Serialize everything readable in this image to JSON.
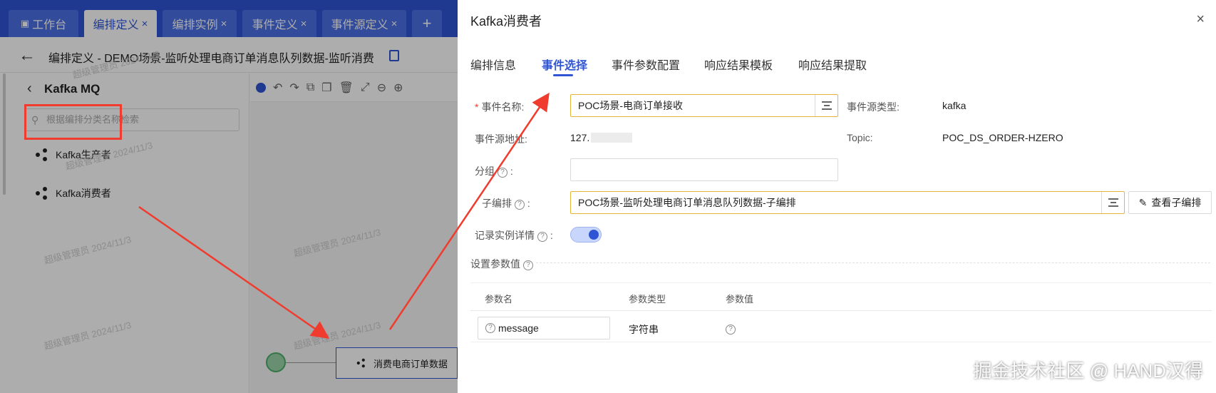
{
  "tabs": [
    {
      "label": "工作台"
    },
    {
      "label": "编排定义"
    },
    {
      "label": "编排实例"
    },
    {
      "label": "事件定义"
    },
    {
      "label": "事件源定义"
    }
  ],
  "tab_close": "×",
  "tab_add": "+",
  "page_title": "编排定义 - DEMO场景-监听处理电商订单消息队列数据-监听消费",
  "left_panel": {
    "title": "Kafka MQ",
    "search_placeholder": "根据编排分类名称检索",
    "items": [
      {
        "label": "Kafka生产者"
      },
      {
        "label": "Kafka消费者"
      }
    ]
  },
  "canvas": {
    "consumer_node_label": "消费电商订单数据"
  },
  "watermark_text": "超级管理员 2024/11/3",
  "drawer": {
    "title": "Kafka消费者",
    "close": "×",
    "tabs": [
      "编排信息",
      "事件选择",
      "事件参数配置",
      "响应结果模板",
      "响应结果提取"
    ],
    "active_tab": 1,
    "form": {
      "event_name_label": "事件名称:",
      "event_name_value": "POC场景-电商订单接收",
      "event_source_type_label": "事件源类型:",
      "event_source_type_value": "kafka",
      "event_source_addr_label": "事件源地址:",
      "event_source_addr_value": "127.",
      "topic_label": "Topic:",
      "topic_value": "POC_DS_ORDER-HZERO",
      "group_label": "分组",
      "group_value": "",
      "sub_orch_label": "子编排",
      "sub_orch_value": "POC场景-监听处理电商订单消息队列数据-子编排",
      "view_sub_label": "查看子编排",
      "record_detail_label": "记录实例详情",
      "record_detail_on": true
    },
    "params": {
      "section_title": "设置参数值",
      "headers": [
        "参数名",
        "参数类型",
        "参数值"
      ],
      "rows": [
        {
          "name": "message",
          "type": "字符串"
        }
      ]
    }
  },
  "brand_watermark": "掘金技术社区 @ HAND汉得",
  "colors": {
    "brand": "#2f55d4",
    "highlight": "#f03c2e",
    "focus_border": "#e5b43a"
  }
}
